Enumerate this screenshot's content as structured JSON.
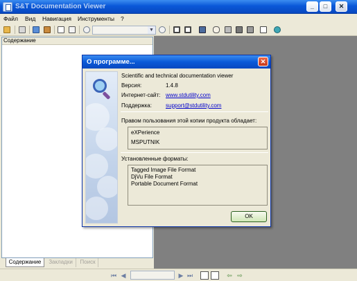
{
  "window": {
    "title": "S&T Documentation Viewer",
    "minimize_label": "_",
    "maximize_label": "□",
    "close_label": "✕"
  },
  "menu": [
    "Файл",
    "Вид",
    "Навигация",
    "Инструменты",
    "?"
  ],
  "toolbar": {
    "icons": [
      "open-icon",
      "print-icon",
      "image-icon",
      "edit-icon",
      "copy-icon",
      "paste-icon",
      "zoom-out-icon",
      "zoom-in-icon",
      "single-page-icon",
      "fit-page-icon",
      "find-icon",
      "hand-icon",
      "select-icon",
      "scan-icon",
      "export-icon",
      "rotate-icon",
      "settings-icon"
    ],
    "zoom_value": ""
  },
  "left_panel": {
    "header": "Содержание",
    "tabs": [
      "Содержание",
      "Закладки",
      "Поиск"
    ]
  },
  "bottom_nav": {
    "first": "⏮",
    "prev": "◀",
    "page": "",
    "next": "▶",
    "last": "⏭",
    "back": "⇦",
    "forward": "⇨"
  },
  "dialog": {
    "title": "О программе...",
    "close_label": "✕",
    "product": "Scientific and technical documentation viewer",
    "version_label": "Версия:",
    "version_value": "1.4.8",
    "site_label": "Интернет-сайт:",
    "site_value": "www.stdutility.com",
    "support_label": "Поддержка:",
    "support_value": "support@stdutility.com",
    "rights_label": "Правом пользования этой копии продукта обладает:",
    "owner_lines": [
      "eXPerience",
      "MSPUTNIK"
    ],
    "formats_label": "Установленные форматы:",
    "formats": [
      "Tagged Image File Format",
      "DjVu File Format",
      "Portable Document Format"
    ],
    "ok_label": "OK"
  }
}
